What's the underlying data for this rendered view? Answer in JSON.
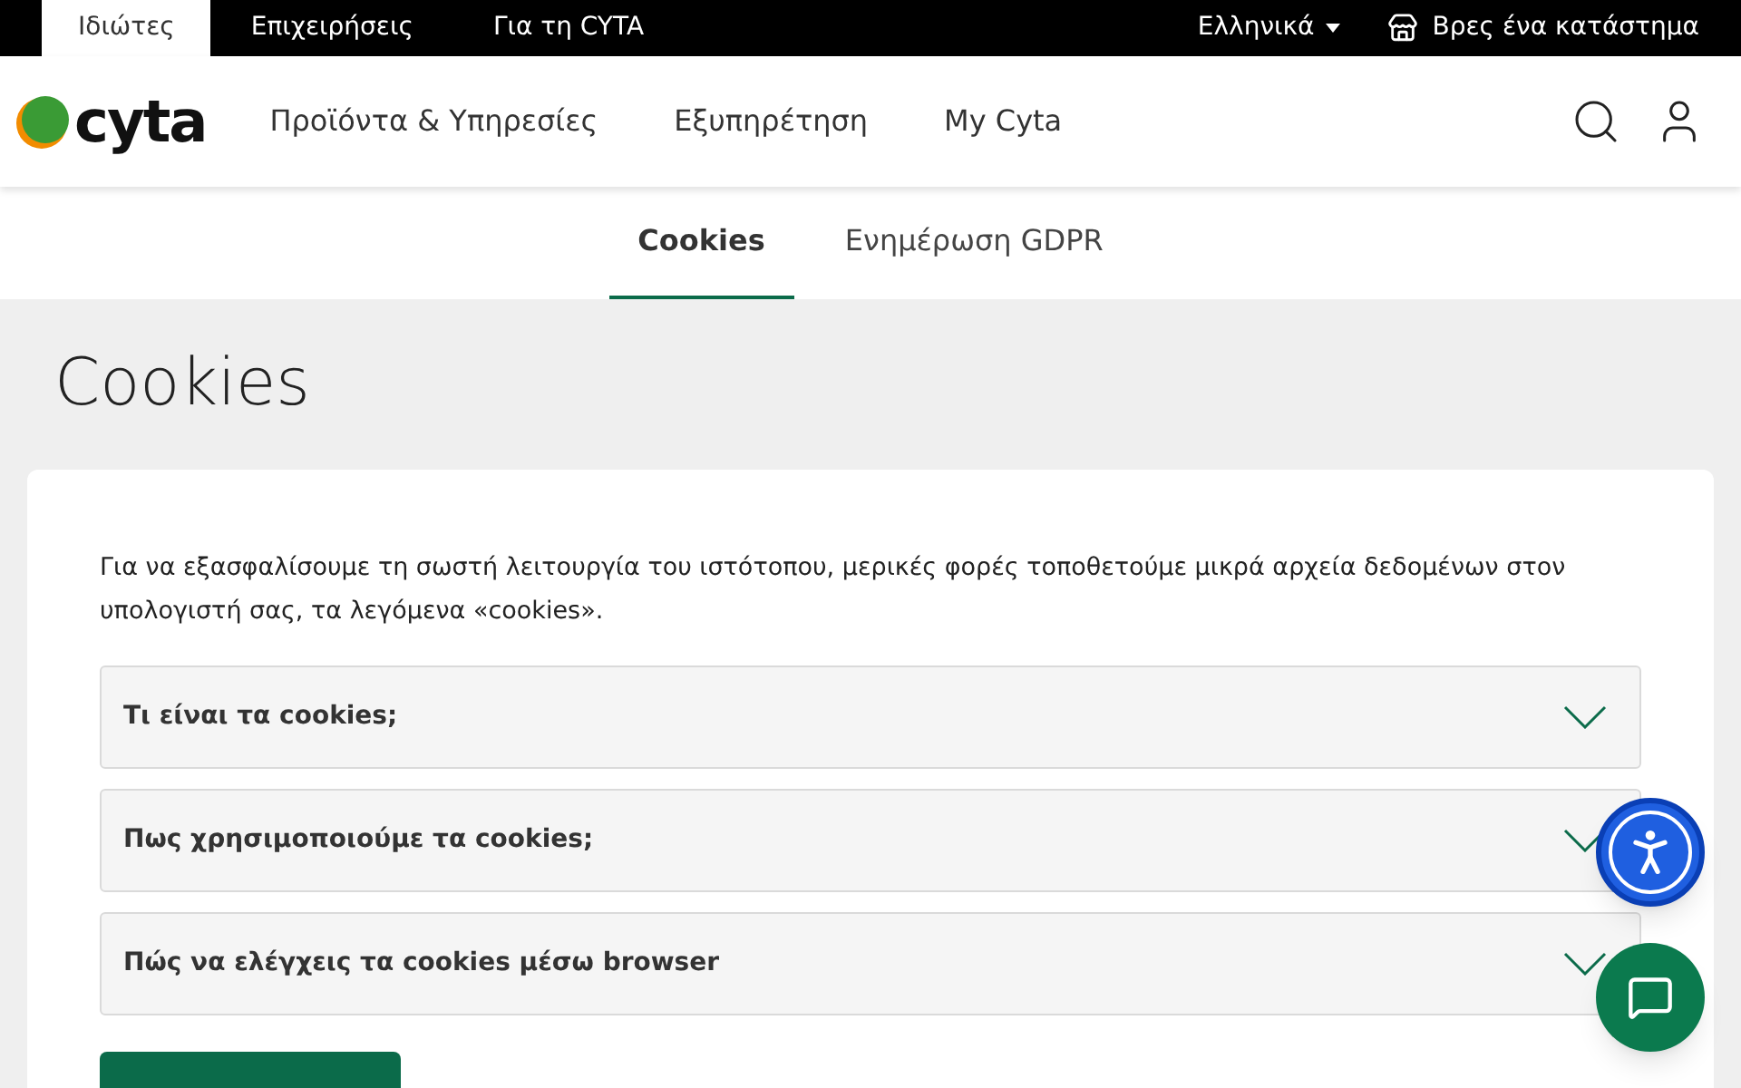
{
  "top_bar": {
    "segments": [
      {
        "label": "Ιδιώτες",
        "selected": true
      },
      {
        "label": "Επιχειρήσεις",
        "selected": false
      },
      {
        "label": "Για τη CYTA",
        "selected": false
      }
    ],
    "language": "Ελληνικά",
    "store_link": "Βρες ένα κατάστημα"
  },
  "header": {
    "logo_text": "cyta",
    "nav": [
      "Προϊόντα & Υπηρεσίες",
      "Εξυπηρέτηση",
      "My Cyta"
    ]
  },
  "tabs": [
    {
      "label": "Cookies",
      "selected": true
    },
    {
      "label": "Ενημέρωση GDPR",
      "selected": false
    }
  ],
  "page_title": "Cookies",
  "intro": "Για να εξασφαλίσουμε τη σωστή λειτουργία του ιστότοπου, μερικές φορές τοποθετούμε μικρά αρχεία δεδομένων στον υπολογιστή σας, τα λεγόμενα «cookies».",
  "accordion": [
    {
      "title": "Τι είναι τα cookies;",
      "expanded": false
    },
    {
      "title": "Πως χρησιμοποιούμε τα cookies;",
      "expanded": false
    },
    {
      "title": "Πώς να ελέγχεις τα cookies μέσω browser",
      "expanded": false
    }
  ]
}
